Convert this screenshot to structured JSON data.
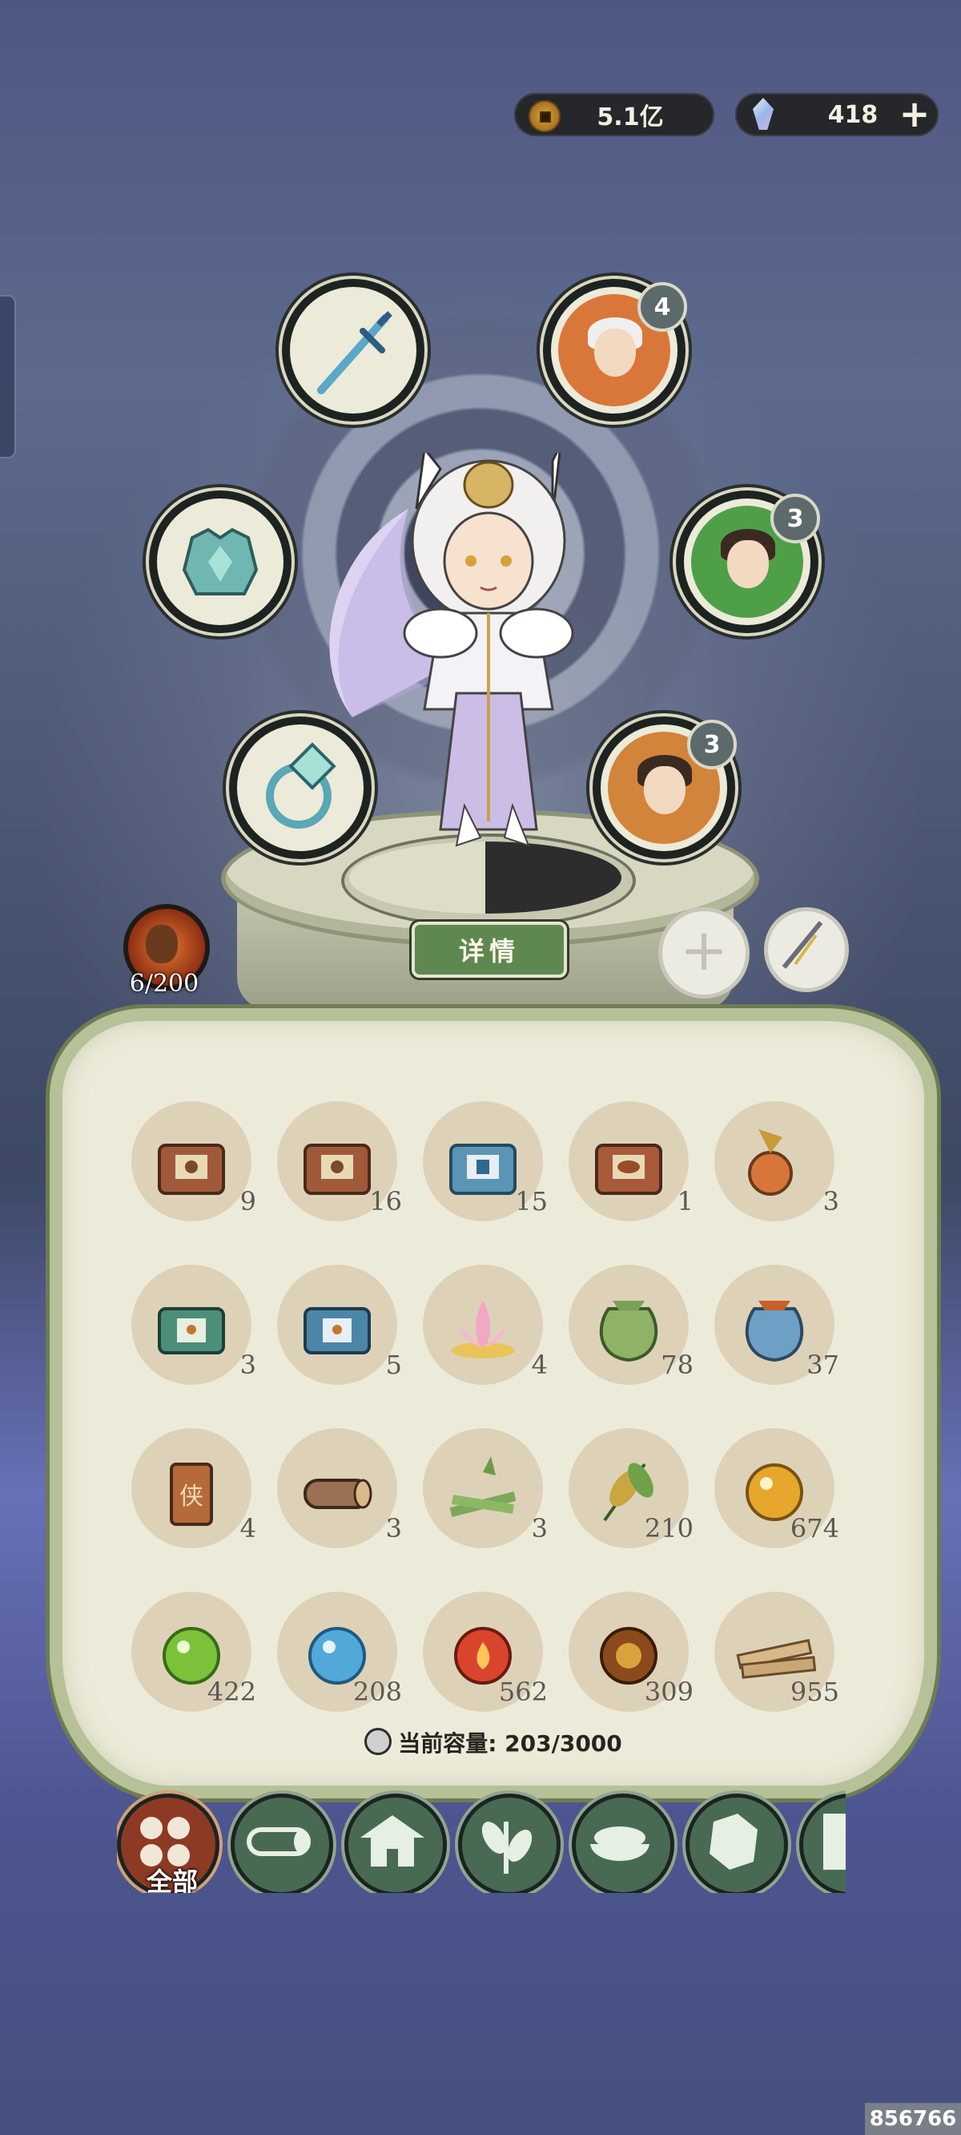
{
  "currency": {
    "coins": "5.1亿",
    "gems": "418",
    "plus_label": "+"
  },
  "equipment_slots": [
    {
      "name": "sword",
      "badge": ""
    },
    {
      "name": "companion-white-hair",
      "badge": "4"
    },
    {
      "name": "armor",
      "badge": ""
    },
    {
      "name": "companion-green",
      "badge": "3"
    },
    {
      "name": "ring",
      "badge": ""
    },
    {
      "name": "companion-orange",
      "badge": "3"
    }
  ],
  "level": {
    "text": "6/200"
  },
  "details_button": "详情",
  "add_slot_label": "+",
  "inventory": {
    "items": [
      {
        "name": "treasure-chest-gold",
        "count": "9"
      },
      {
        "name": "treasure-chest-gold-2",
        "count": "16"
      },
      {
        "name": "treasure-chest-blue",
        "count": "15"
      },
      {
        "name": "treasure-chest-bronze",
        "count": "1"
      },
      {
        "name": "fruit-bag",
        "count": "3"
      },
      {
        "name": "jade-chest-green",
        "count": "3"
      },
      {
        "name": "jade-chest-blue",
        "count": "5"
      },
      {
        "name": "lotus",
        "count": "4"
      },
      {
        "name": "green-pouch",
        "count": "78"
      },
      {
        "name": "blue-pouch",
        "count": "37"
      },
      {
        "name": "wooden-tag",
        "count": "4"
      },
      {
        "name": "log",
        "count": "3"
      },
      {
        "name": "bamboo",
        "count": "3"
      },
      {
        "name": "herb-leaves",
        "count": "210"
      },
      {
        "name": "gold-orb",
        "count": "674"
      },
      {
        "name": "green-orb",
        "count": "422"
      },
      {
        "name": "blue-orb",
        "count": "208"
      },
      {
        "name": "fire-orb",
        "count": "562"
      },
      {
        "name": "amber-orb",
        "count": "309"
      },
      {
        "name": "wood-planks",
        "count": "955"
      }
    ],
    "capacity_label": "当前容量: 203/3000"
  },
  "tabs": [
    {
      "name": "all",
      "label": "全部"
    },
    {
      "name": "wood",
      "label": ""
    },
    {
      "name": "building",
      "label": ""
    },
    {
      "name": "herb",
      "label": ""
    },
    {
      "name": "food",
      "label": ""
    },
    {
      "name": "ore",
      "label": ""
    },
    {
      "name": "scroll",
      "label": ""
    }
  ],
  "watermark": "856766",
  "colors": {
    "panel_bg": "#ecebd9",
    "panel_border": "#b7c197",
    "details_green": "#5f8850",
    "tab_active": "#8d3a24",
    "tab_inactive": "#486a53"
  }
}
